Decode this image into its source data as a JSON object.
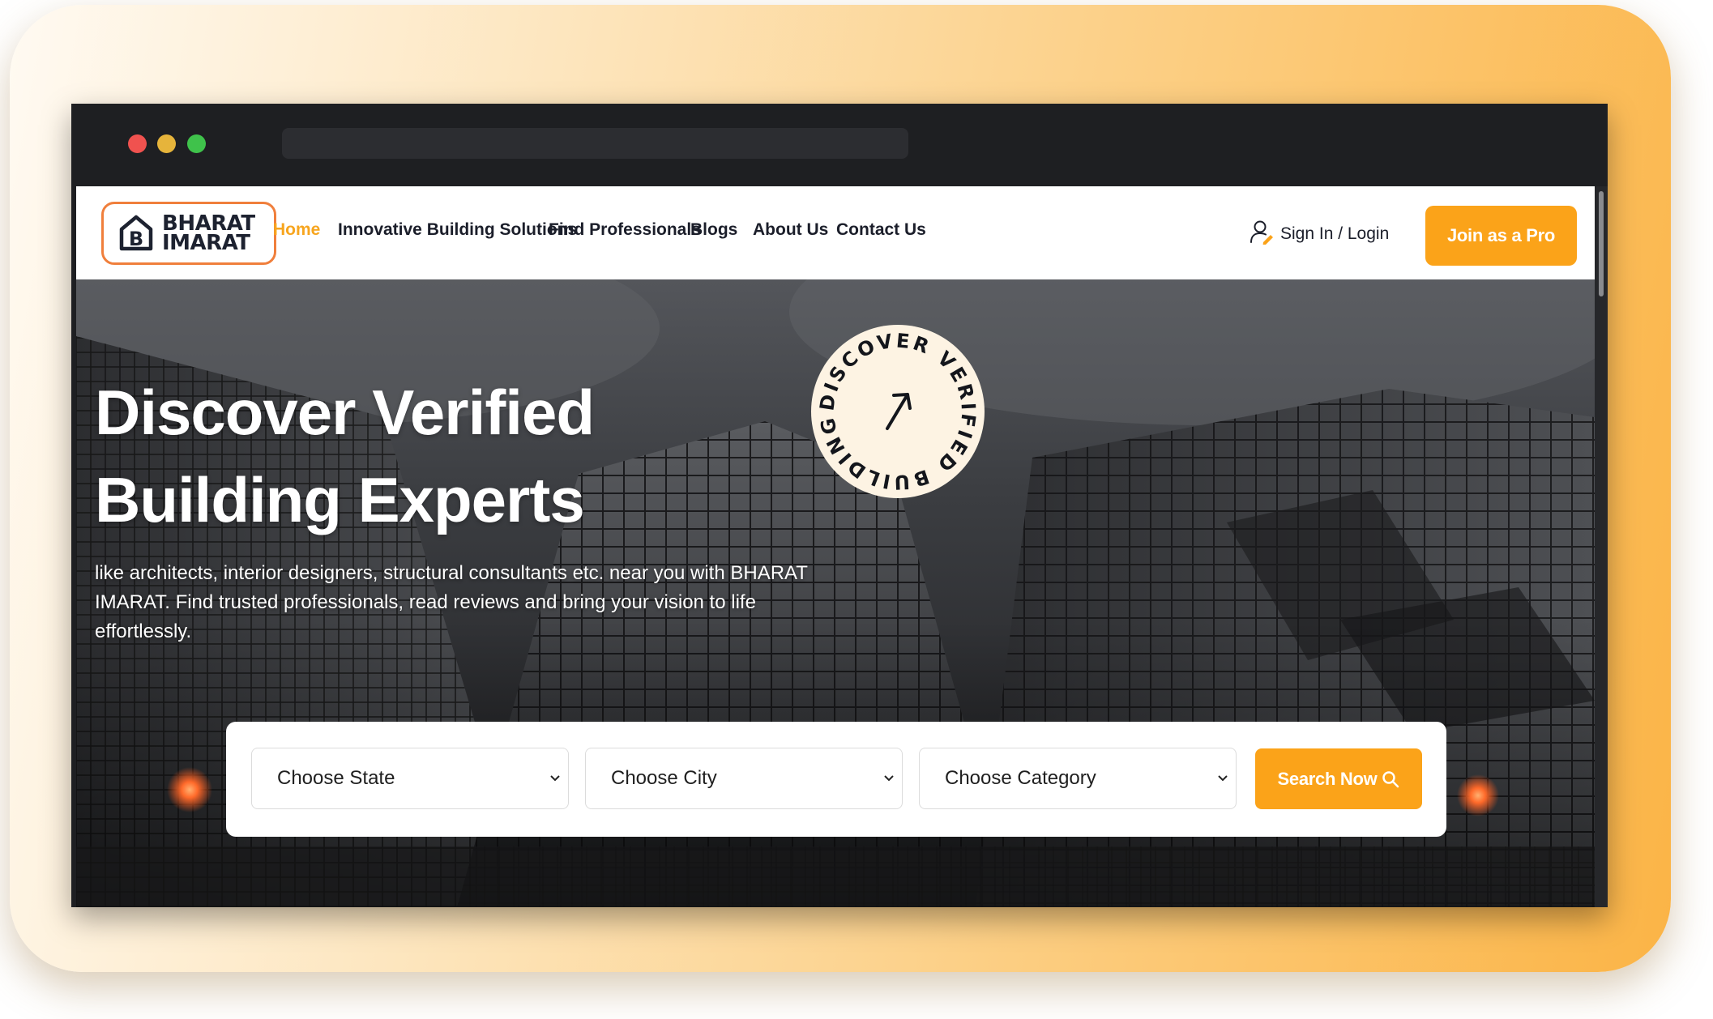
{
  "brand": {
    "line1": "BHARAT",
    "line2": "IMARAT",
    "border_color": "#f07f3c"
  },
  "nav": {
    "items": [
      {
        "label": "Home",
        "active": true
      },
      {
        "label": "Innovative Building Solutions",
        "active": false
      },
      {
        "label": "Find Professionals",
        "active": false
      },
      {
        "label": "Blogs",
        "active": false
      },
      {
        "label": "About Us",
        "active": false
      },
      {
        "label": "Contact Us",
        "active": false
      }
    ],
    "signin_label": "Sign In / Login",
    "join_label": "Join as a Pro"
  },
  "hero": {
    "title_line1": "Discover Verified",
    "title_line2": "Building Experts",
    "subtitle": "like architects, interior designers, structural consultants etc. near you with BHARAT IMARAT. Find trusted professionals, read reviews and bring your vision to life effortlessly.",
    "badge_text": "DISCOVER VERIFIED BUILDING EXPERTS"
  },
  "search": {
    "state_label": "Choose State",
    "city_label": "Choose City",
    "category_label": "Choose Category",
    "button_label": "Search Now"
  },
  "icons": {
    "logo": "house-b-logo-icon",
    "signin": "user-icon",
    "badge_arrow": "arrow-up-right-icon",
    "dropdown": "chevron-down-icon",
    "search": "search-icon"
  },
  "colors": {
    "accent": "#fba319",
    "active_nav": "#f7a51e",
    "nav_text": "#1b1e2a",
    "badge_bg": "#fdf3e3",
    "chrome_bg": "#1e1f22"
  },
  "window_controls": [
    "close",
    "minimize",
    "maximize"
  ]
}
